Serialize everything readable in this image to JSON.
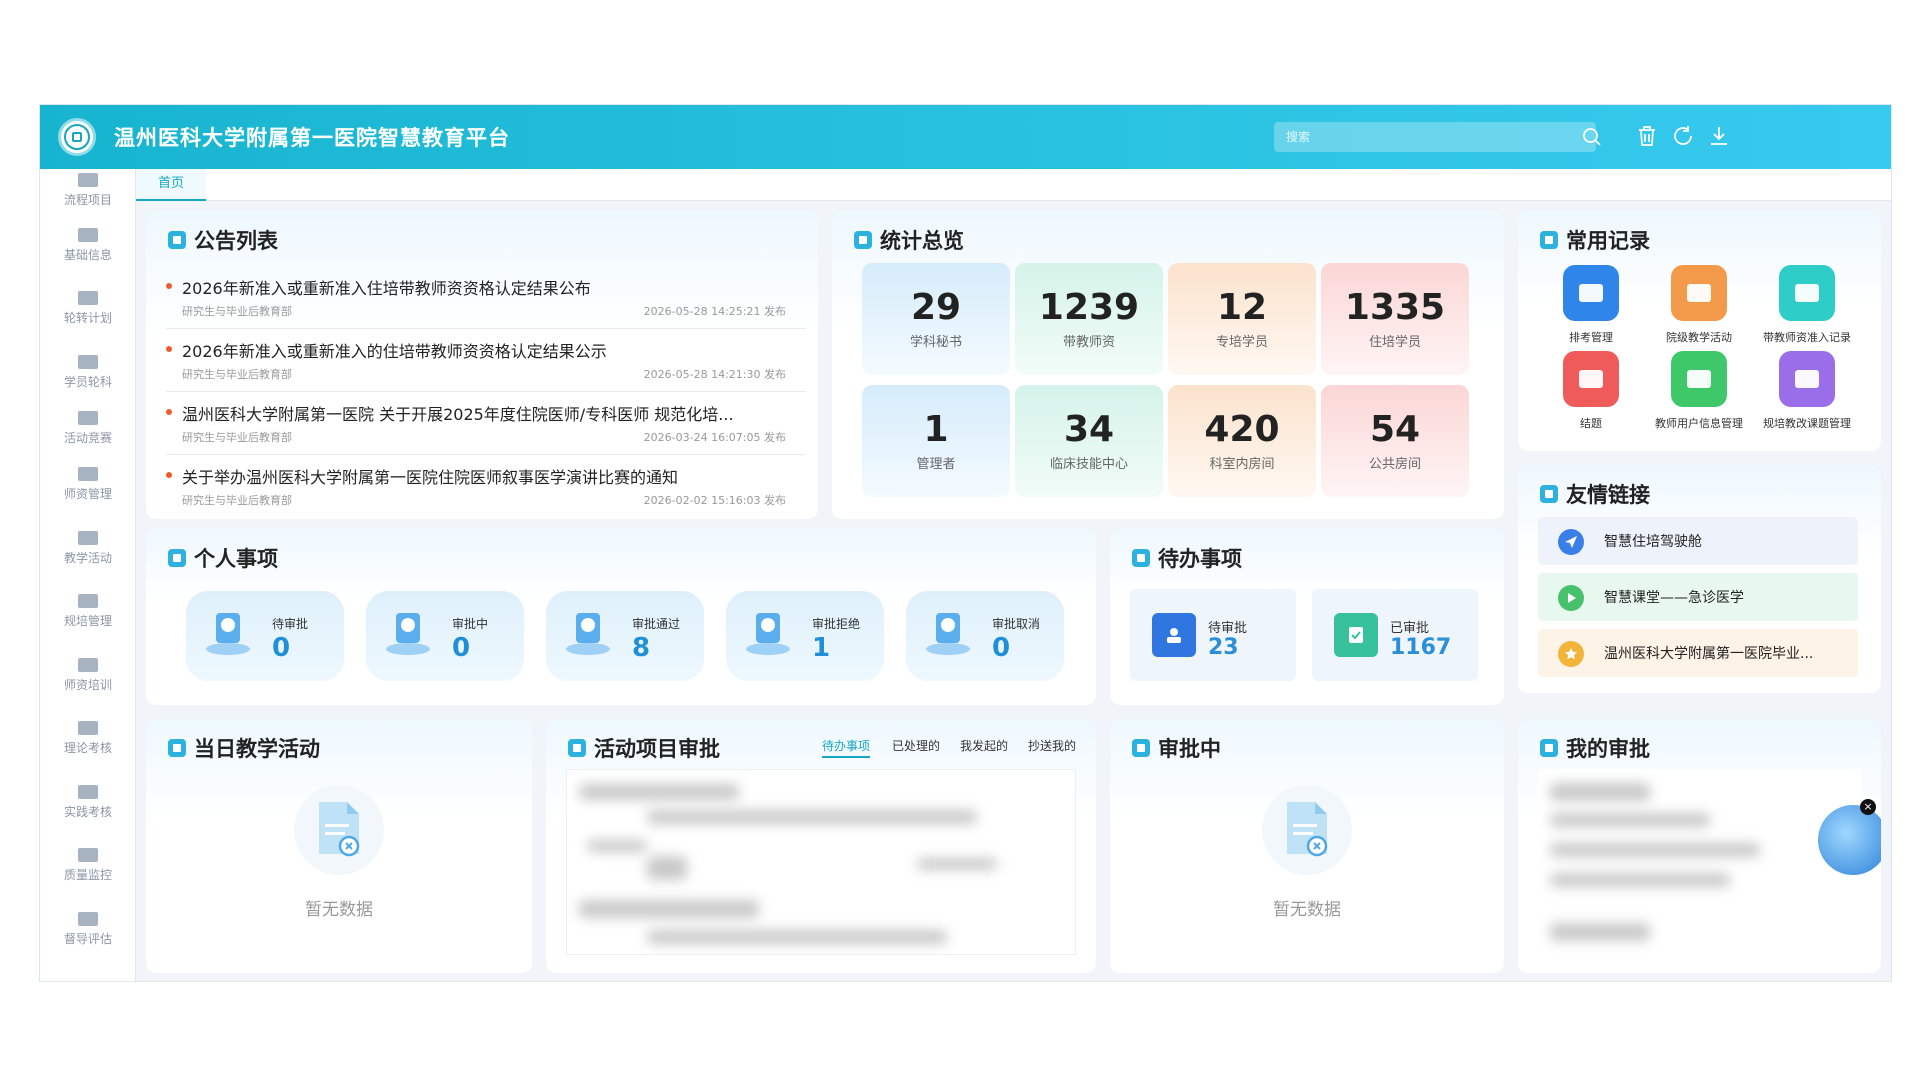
{
  "header": {
    "title": "温州医科大学附属第一医院智慧教育平台",
    "search_placeholder": "搜索"
  },
  "sidebar": {
    "items": [
      {
        "label": "流程项目"
      },
      {
        "label": "基础信息"
      },
      {
        "label": "轮转计划"
      },
      {
        "label": "学员轮科"
      },
      {
        "label": "活动竞赛"
      },
      {
        "label": "师资管理"
      },
      {
        "label": "教学活动"
      },
      {
        "label": "规培管理"
      },
      {
        "label": "师资培训"
      },
      {
        "label": "理论考核"
      },
      {
        "label": "实践考核"
      },
      {
        "label": "质量监控"
      },
      {
        "label": "督导评估"
      }
    ]
  },
  "tabs": [
    {
      "label": "首页"
    }
  ],
  "announcements": {
    "title": "公告列表",
    "items": [
      {
        "title": "2026年新准入或重新准入住培带教师资资格认定结果公布",
        "dept": "研究生与毕业后教育部",
        "time": "2026-05-28 14:25:21 发布"
      },
      {
        "title": "2026年新准入或重新准入的住培带教师资资格认定结果公示",
        "dept": "研究生与毕业后教育部",
        "time": "2026-05-28 14:21:30 发布"
      },
      {
        "title": "温州医科大学附属第一医院 关于开展2025年度住院医师/专科医师 规范化培...",
        "dept": "研究生与毕业后教育部",
        "time": "2026-03-24 16:07:05 发布"
      },
      {
        "title": "关于举办温州医科大学附属第一医院住院医师叙事医学演讲比赛的通知",
        "dept": "研究生与毕业后教育部",
        "time": "2026-02-02 15:16:03 发布"
      }
    ]
  },
  "stats": {
    "title": "统计总览",
    "items": [
      {
        "value": "29",
        "label": "学科秘书",
        "color": "blue"
      },
      {
        "value": "1239",
        "label": "带教师资",
        "color": "green"
      },
      {
        "value": "12",
        "label": "专培学员",
        "color": "orange"
      },
      {
        "value": "1335",
        "label": "住培学员",
        "color": "red"
      },
      {
        "value": "1",
        "label": "管理者",
        "color": "blue"
      },
      {
        "value": "34",
        "label": "临床技能中心",
        "color": "green"
      },
      {
        "value": "420",
        "label": "科室内房间",
        "color": "orange"
      },
      {
        "value": "54",
        "label": "公共房间",
        "color": "red"
      }
    ]
  },
  "records": {
    "title": "常用记录",
    "items": [
      {
        "label": "排考管理",
        "color": "#2f86e8"
      },
      {
        "label": "院级教学活动",
        "color": "#f29a4a"
      },
      {
        "label": "带教师资准入记录",
        "color": "#2fcdc7"
      },
      {
        "label": "结题",
        "color": "#ef5b5b"
      },
      {
        "label": "教师用户信息管理",
        "color": "#3fc86a"
      },
      {
        "label": "规培教改课题管理",
        "color": "#9a6ee8"
      }
    ]
  },
  "links": {
    "title": "友情链接",
    "items": [
      {
        "label": "智慧住培驾驶舱",
        "bg": "#eef3fb",
        "icon_color": "#3a7ee8"
      },
      {
        "label": "智慧课堂——急诊医学",
        "bg": "#e9f8ee",
        "icon_color": "#47c16b"
      },
      {
        "label": "温州医科大学附属第一医院毕业...",
        "bg": "#fdf3e6",
        "icon_color": "#f2b53a"
      }
    ]
  },
  "personal": {
    "title": "个人事项",
    "items": [
      {
        "label": "待审批",
        "value": "0"
      },
      {
        "label": "审批中",
        "value": "0"
      },
      {
        "label": "审批通过",
        "value": "8"
      },
      {
        "label": "审批拒绝",
        "value": "1"
      },
      {
        "label": "审批取消",
        "value": "0"
      }
    ]
  },
  "todo": {
    "title": "待办事项",
    "items": [
      {
        "label": "待审批",
        "value": "23",
        "color": "#2f76e0"
      },
      {
        "label": "已审批",
        "value": "1167",
        "color": "#37c19a"
      }
    ]
  },
  "daily": {
    "title": "当日教学活动",
    "empty": "暂无数据"
  },
  "activity": {
    "title": "活动项目审批",
    "tabs": [
      "待办事项",
      "已处理的",
      "我发起的",
      "抄送我的"
    ]
  },
  "approving": {
    "title": "审批中",
    "empty": "暂无数据"
  },
  "my_approval": {
    "title": "我的审批"
  }
}
